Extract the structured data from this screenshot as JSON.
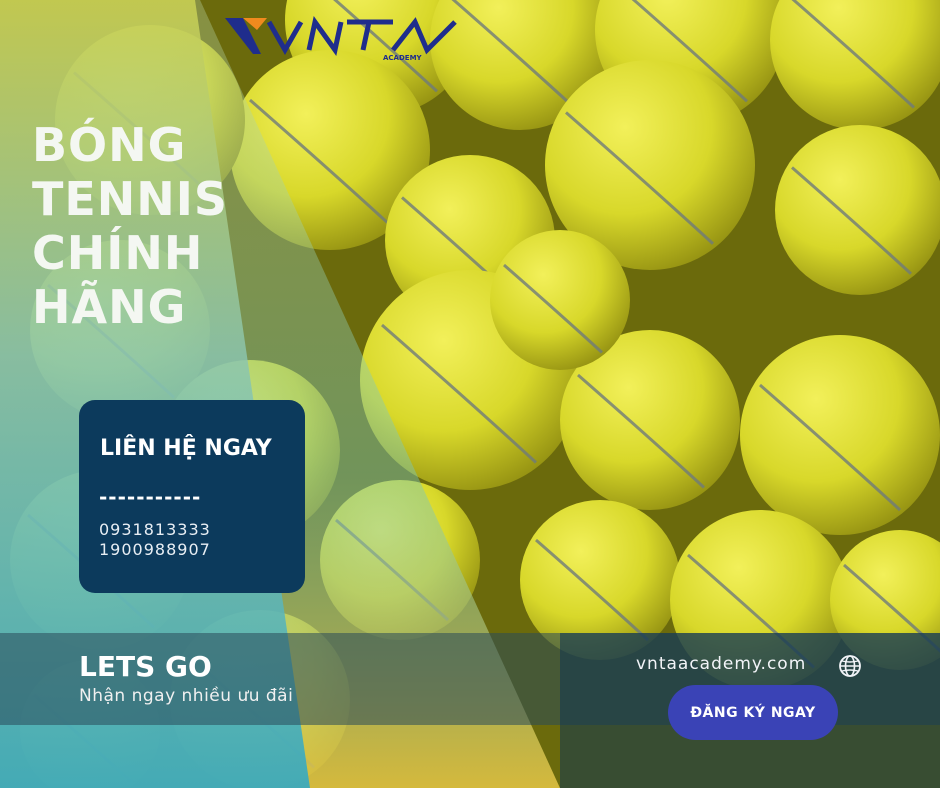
{
  "brand": {
    "logo_text": "VNTA",
    "logo_sub": "ACADEMY"
  },
  "headline": [
    "BÓNG",
    "TENNIS",
    "CHÍNH",
    "HÃNG"
  ],
  "contact": {
    "label": "LIÊN HỆ NGAY",
    "divider": "-----------",
    "phones": [
      "0931813333",
      "1900988907"
    ]
  },
  "promo": {
    "title": "LETS GO",
    "subtitle": "Nhận ngay nhiều ưu đãi"
  },
  "website": "vntaacademy.com",
  "cta_label": "ĐĂNG KÝ NGAY",
  "colors": {
    "navy": "#0c3a5c",
    "button": "#3a43b6",
    "ball": "#d8dc2a",
    "teal": "#3aa6b8"
  }
}
